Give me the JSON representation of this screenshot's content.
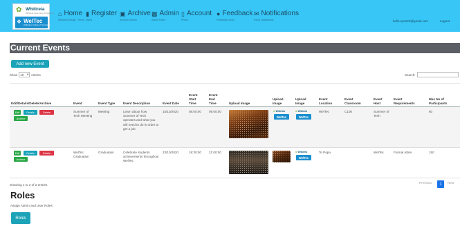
{
  "brand": {
    "name": "Whitireia",
    "tagline": "Whitireia Community Polytechnic",
    "badge": "WelTec",
    "badge_sub": "Wellington Institute of Technology",
    "accent": "#37c6f6"
  },
  "nav": {
    "items": [
      {
        "label": "Home",
        "sub": "Whitireia Design · Home",
        "icon": "home-icon"
      },
      {
        "label": "Register",
        "sub": "Users",
        "icon": "book-icon"
      },
      {
        "label": "Archive",
        "sub": "Archived events",
        "icon": "archive-icon"
      },
      {
        "label": "Admin",
        "sub": "Admin Panel",
        "icon": "briefcase-icon"
      },
      {
        "label": "Account",
        "sub": "Profile",
        "icon": "document-icon"
      },
      {
        "label": "Feedback",
        "sub": "Feedback center",
        "icon": "comment-icon"
      },
      {
        "label": "Notifications",
        "sub": "Event notifications",
        "icon": "envelope-icon"
      }
    ],
    "user_email": "hello.xyz123@gmail.com",
    "logout": "Logout"
  },
  "page_title": "Current Events",
  "add_button": "Add new Event",
  "show_entries": {
    "prefix": "Show",
    "value": "10",
    "suffix": "entries"
  },
  "search_label": "Search:",
  "table": {
    "headers": [
      "Edit/Details/Delete/Archive",
      "Event",
      "Event Type",
      "Event Description",
      "Event Date",
      "Event Start Time",
      "Event End Time",
      "Upload Image",
      "Upload Image",
      "Upload Image",
      "Event Location",
      "Event Classroom",
      "Event Host",
      "Event Requirements",
      "Max No of Participants"
    ],
    "actions": {
      "edit": "Edit",
      "details": "Details",
      "delete": "Delete",
      "archive": "Archive"
    },
    "rows": [
      {
        "event": "Summer of Tech Meeting",
        "type": "Meeting",
        "description": "Learn about how Summer of Tech operates and what you will need to do in order to get a job",
        "date": "15/10/2020",
        "start": "08:00:00",
        "end": "09:00:00",
        "location": "WelTec",
        "classroom": "C106",
        "host": "Summer of Tech",
        "requirements": "",
        "max": "60"
      },
      {
        "event": "WelTec Graduation",
        "type": "Graduation",
        "description": "Celebrate students achievements throughout WelTec",
        "date": "23/10/2020",
        "start": "18:30:00",
        "end": "21:00:00",
        "location": "Te Papa",
        "classroom": "",
        "host": "WelTec",
        "requirements": "Formal Attire",
        "max": "150"
      }
    ],
    "mini_logo_top": "Whitireia",
    "mini_logo_badge": "WelTec"
  },
  "footer": {
    "showing": "Showing 1 to 2 of 2 entries",
    "previous": "Previous",
    "page": "1",
    "next": "Next"
  },
  "roles": {
    "title": "Roles",
    "subtitle": "Assign Admin and User Roles",
    "button": "Roles"
  }
}
